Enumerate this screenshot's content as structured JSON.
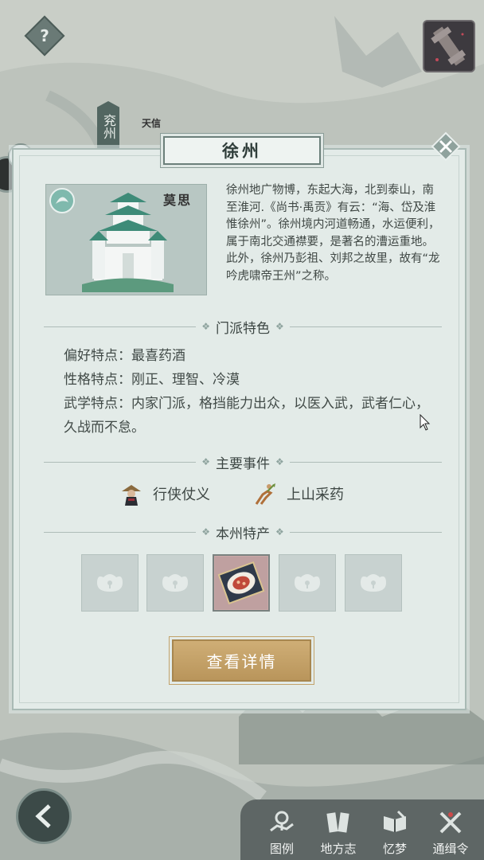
{
  "map": {
    "help_icon": "?",
    "city_tag": "兖州",
    "city_name": "天信",
    "alert_icon": "!"
  },
  "dialog": {
    "title": "徐州",
    "sign": "莫思",
    "description": "徐州地广物博，东起大海，北到泰山，南至淮河.《尚书·禹贡》有云：“海、岱及淮惟徐州”。徐州境内河道畅通，水运便利，属于南北交通襟要，是著名的漕运重地。此外，徐州乃彭祖、刘邦之故里，故有“龙吟虎啸帝王州”之称。",
    "section_traits": "门派特色",
    "traits": [
      {
        "text": "偏好特点：最喜药酒"
      },
      {
        "text": "性格特点：刚正、理智、冷漠"
      },
      {
        "text": "武学特点：内家门派，格挡能力出众，以医入武，武者仁心，久战而不怠。"
      }
    ],
    "section_events": "主要事件",
    "events": [
      {
        "label": "行侠仗义",
        "icon": "straw-hat-hero-icon"
      },
      {
        "label": "上山采药",
        "icon": "herb-gatherer-icon"
      }
    ],
    "section_products": "本州特产",
    "products": [
      {
        "state": "locked"
      },
      {
        "state": "locked"
      },
      {
        "state": "filled"
      },
      {
        "state": "locked"
      },
      {
        "state": "locked"
      }
    ],
    "detail_button": "查看详情"
  },
  "bottom_nav": [
    {
      "label": "图例",
      "icon": "legend-map-icon"
    },
    {
      "label": "地方志",
      "icon": "local-chronicle-icon"
    },
    {
      "label": "忆梦",
      "icon": "dream-book-icon"
    },
    {
      "label": "通缉令",
      "icon": "wanted-swords-icon"
    }
  ],
  "colors": {
    "dialog_bg": "#e3ebe8",
    "accent_gold": "#c2a36b",
    "nav_bar": "#464e4d"
  }
}
